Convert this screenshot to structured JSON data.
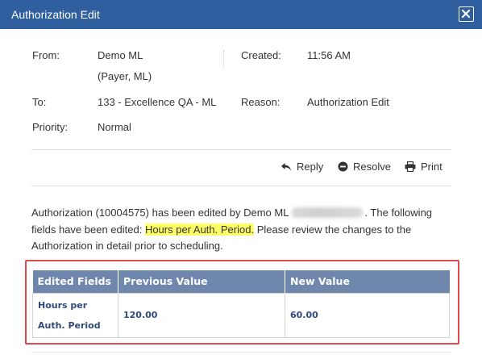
{
  "dialog": {
    "title": "Authorization Edit",
    "close_icon": "close-icon"
  },
  "header": {
    "from_label": "From:",
    "from_name": "Demo ML",
    "from_role": "(Payer, ML)",
    "created_label": "Created:",
    "created_value": "11:56 AM",
    "to_label": "To:",
    "to_value": "133 - Excellence QA - ML",
    "reason_label": "Reason:",
    "reason_value": "Authorization Edit",
    "priority_label": "Priority:",
    "priority_value": "Normal"
  },
  "actions": {
    "reply_label": "Reply",
    "resolve_label": "Resolve",
    "print_label": "Print"
  },
  "message": {
    "part1": "Authorization (10004575) has been edited by Demo ML",
    "part2": ". The following fields have been edited: ",
    "highlight": "Hours per Auth. Period.",
    "part3": " Please review the changes to the Authorization in detail prior to scheduling."
  },
  "edits_table": {
    "headers": [
      "Edited Fields",
      "Previous Value",
      "New Value"
    ],
    "rows": [
      {
        "field": "Hours per Auth. Period",
        "previous": "120.00",
        "new": "60.00"
      }
    ]
  },
  "colors": {
    "title_bar": "#2f5f9e",
    "table_header": "#6f86ad",
    "highlight": "#ffff66",
    "annotation_box": "#e0494d"
  }
}
